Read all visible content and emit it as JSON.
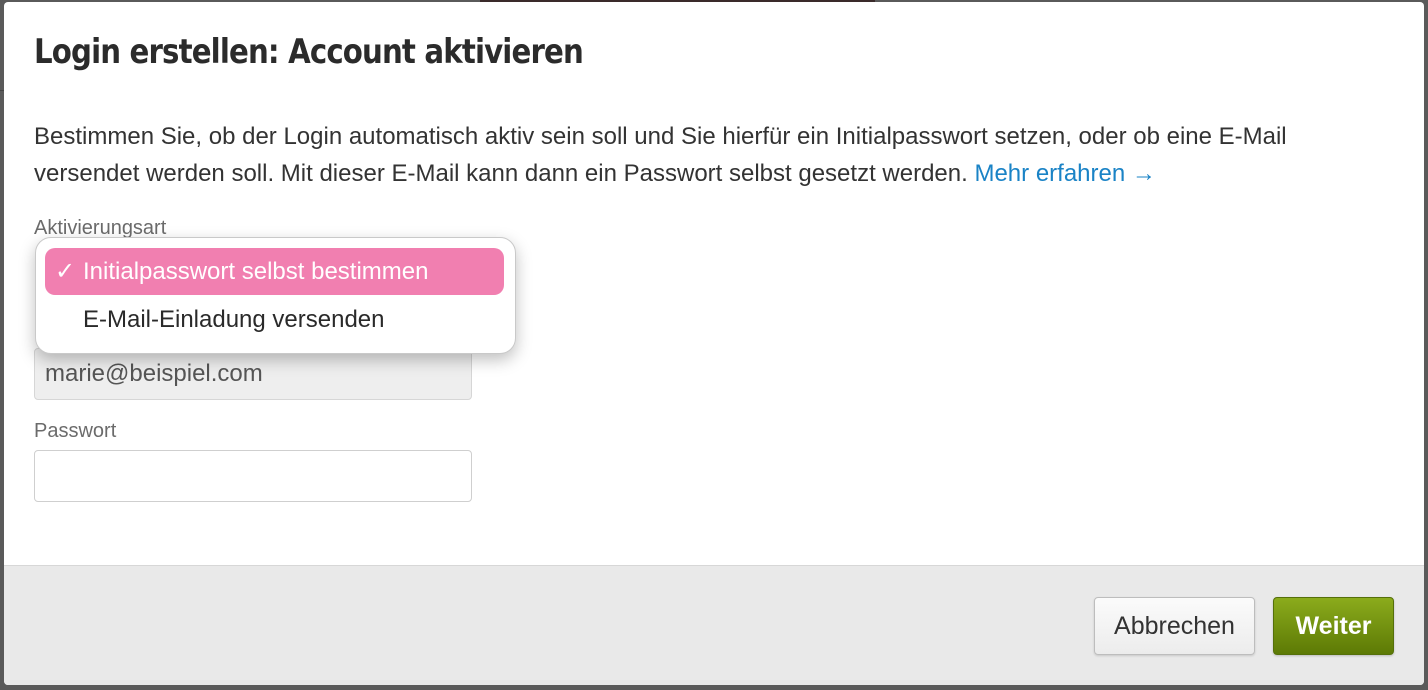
{
  "dialog": {
    "title": "Login erstellen: Account aktivieren",
    "description": "Bestimmen Sie, ob der Login automatisch aktiv sein soll und Sie hierfür ein Initialpasswort setzen, oder ob eine E-Mail versendet werden soll. Mit dieser E-Mail kann dann ein Passwort selbst gesetzt werden.",
    "learn_more_label": "Mehr erfahren →"
  },
  "form": {
    "activation_type_label": "Aktivierungsart",
    "activation_options": [
      {
        "label": "Initialpasswort selbst bestimmen",
        "selected": true,
        "check": "✓"
      },
      {
        "label": "E-Mail-Einladung versenden",
        "selected": false,
        "check": ""
      }
    ],
    "email_value": "marie@beispiel.com",
    "password_label": "Passwort",
    "password_value": ""
  },
  "footer": {
    "cancel_label": "Abbrechen",
    "next_label": "Weiter"
  },
  "colors": {
    "selected_option": "#f17fb0",
    "link": "#1a83c6",
    "primary_button": "#6f8c0e"
  }
}
